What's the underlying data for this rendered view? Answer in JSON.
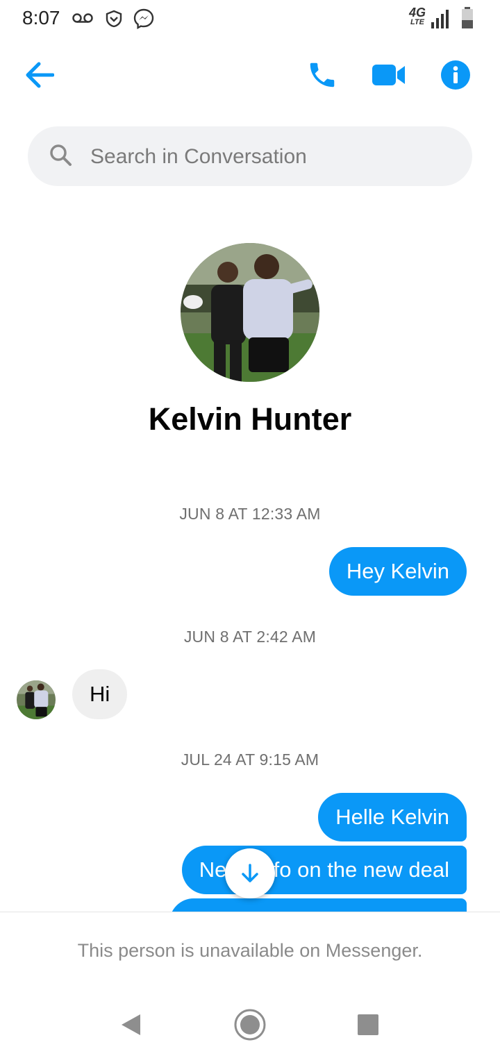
{
  "status_bar": {
    "time": "8:07",
    "network": "4G",
    "network_sub": "LTE",
    "icons": [
      "voicemail-icon",
      "vpn-shield-icon",
      "messenger-icon",
      "signal-icon",
      "battery-icon"
    ]
  },
  "top_bar": {
    "icons": [
      "back-arrow-icon",
      "phone-icon",
      "video-camera-icon",
      "info-icon"
    ],
    "accent_color": "#0a98f7"
  },
  "search": {
    "placeholder": "Search in Conversation"
  },
  "profile": {
    "name": "Kelvin Hunter"
  },
  "conversation": {
    "timestamps": [
      "JUN 8 AT 12:33 AM",
      "JUN 8 AT 2:42 AM",
      "JUL 24 AT 9:15 AM"
    ],
    "messages": [
      {
        "direction": "outgoing",
        "text": "Hey Kelvin"
      },
      {
        "direction": "incoming",
        "text": "Hi"
      },
      {
        "direction": "outgoing",
        "text": "Helle Kelvin"
      },
      {
        "direction": "outgoing",
        "text": "Need info on the new deal"
      }
    ]
  },
  "footer": {
    "notice": "This person is unavailable on Messenger."
  },
  "colors": {
    "outgoing_bubble": "#0a98f7",
    "incoming_bubble": "#efefef",
    "timestamp_text": "#6f6f6f"
  }
}
